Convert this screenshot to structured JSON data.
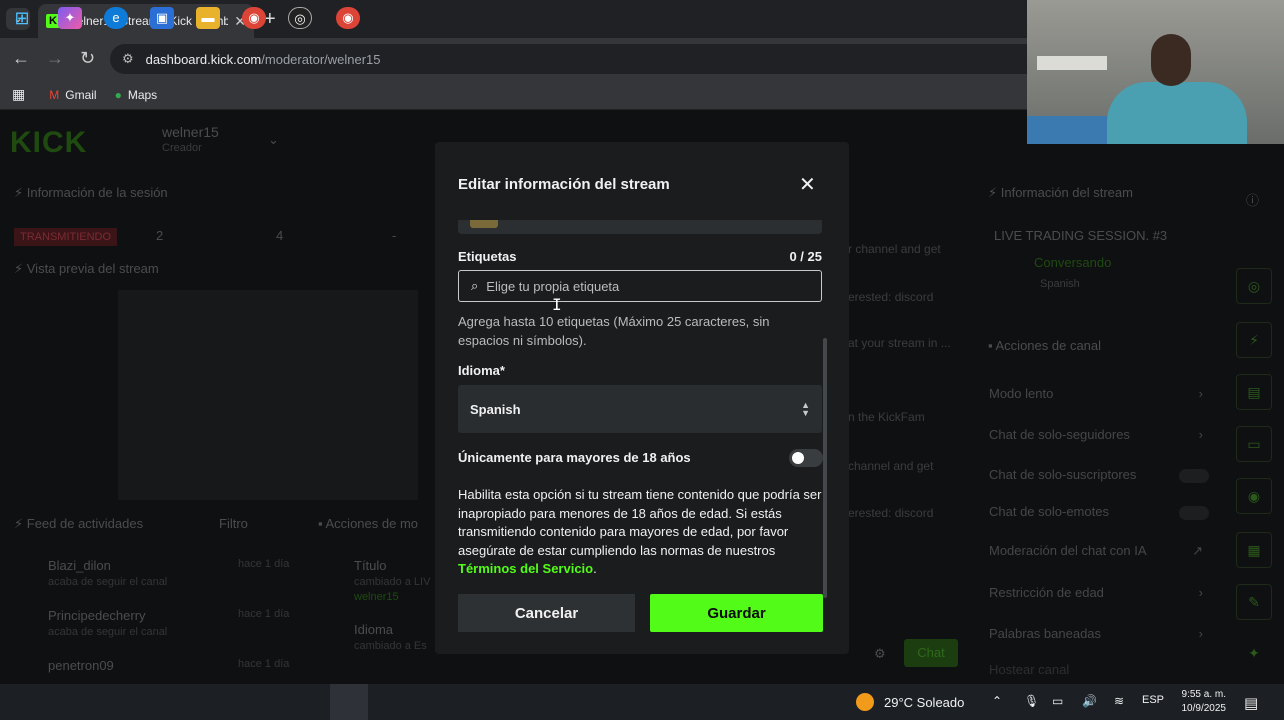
{
  "browser": {
    "tab_title": "welner15 Stream - Kick Dashbo",
    "url_host": "dashboard.kick.com",
    "url_path": "/moderator/welner15",
    "bookmarks": [
      {
        "label": "Gmail",
        "icon": "gmail-icon"
      },
      {
        "label": "Maps",
        "icon": "maps-icon"
      }
    ]
  },
  "dashboard": {
    "logo": "KICK",
    "username": "welner15",
    "role": "Creador",
    "session_title": "Información de la sesión",
    "live_badge": "TRANSMITIENDO",
    "stats": [
      "2",
      "4",
      "-"
    ],
    "preview_title": "Vista previa del stream",
    "feed_title": "Feed de actividades",
    "feed_filter": "Filtro",
    "feed": [
      {
        "name": "Blazi_dilon",
        "action": "acaba de seguir el canal",
        "time": "hace 1 día"
      },
      {
        "name": "Principedecherry",
        "action": "acaba de seguir el canal",
        "time": "hace 1 día"
      },
      {
        "name": "penetron09",
        "action": "",
        "time": "hace 1 día"
      }
    ],
    "mod_actions_title": "Acciones de mo",
    "mod_actions": [
      {
        "label": "Título",
        "detail": "cambiado a LIV",
        "user": "welner15"
      },
      {
        "label": "Idioma",
        "detail": "cambiado a Es"
      }
    ],
    "chat_lines": [
      "r channel and get",
      "erested: discord",
      "at your stream in ...",
      "n the KickFam",
      "channel and get",
      "erested: discord"
    ],
    "chat_button": "Chat",
    "stream_info_title": "Información del stream",
    "stream_name": "LIVE TRADING SESSION. #3",
    "category": "Conversando",
    "language_tag": "Spanish",
    "channel_actions_title": "Acciones de canal",
    "channel_actions": [
      "Modo lento",
      "Chat de solo-seguidores",
      "Chat de solo-suscriptores",
      "Chat de solo-emotes",
      "Moderación del chat con IA",
      "Restricción de edad",
      "Palabras baneadas",
      "Hostear canal"
    ]
  },
  "modal": {
    "title": "Editar información del stream",
    "tags_label": "Etiquetas",
    "tags_counter": "0 / 25",
    "tags_placeholder": "Elige tu propia etiqueta",
    "tags_help": "Agrega hasta 10 etiquetas (Máximo 25 caracteres, sin espacios ni símbolos).",
    "language_label": "Idioma*",
    "language_value": "Spanish",
    "adult_label": "Únicamente para mayores de 18 años",
    "adult_enabled": false,
    "adult_desc": "Habilita esta opción si tu stream tiene contenido que podría ser inapropiado para menores de 18 años de edad. Si estás transmitiendo contenido para mayores de edad, por favor asegúrate de estar cumpliendo las normas de nuestros ",
    "adult_desc_link": "Términos del Servicio",
    "adult_desc_end": ".",
    "cancel_label": "Cancelar",
    "save_label": "Guardar"
  },
  "taskbar": {
    "weather": "29°C Soleado",
    "lang": "ESP",
    "time": "9:55 a. m.",
    "date": "10/9/2025"
  },
  "colors": {
    "accent": "#53fc18",
    "modal_bg": "#1a1c1e"
  }
}
